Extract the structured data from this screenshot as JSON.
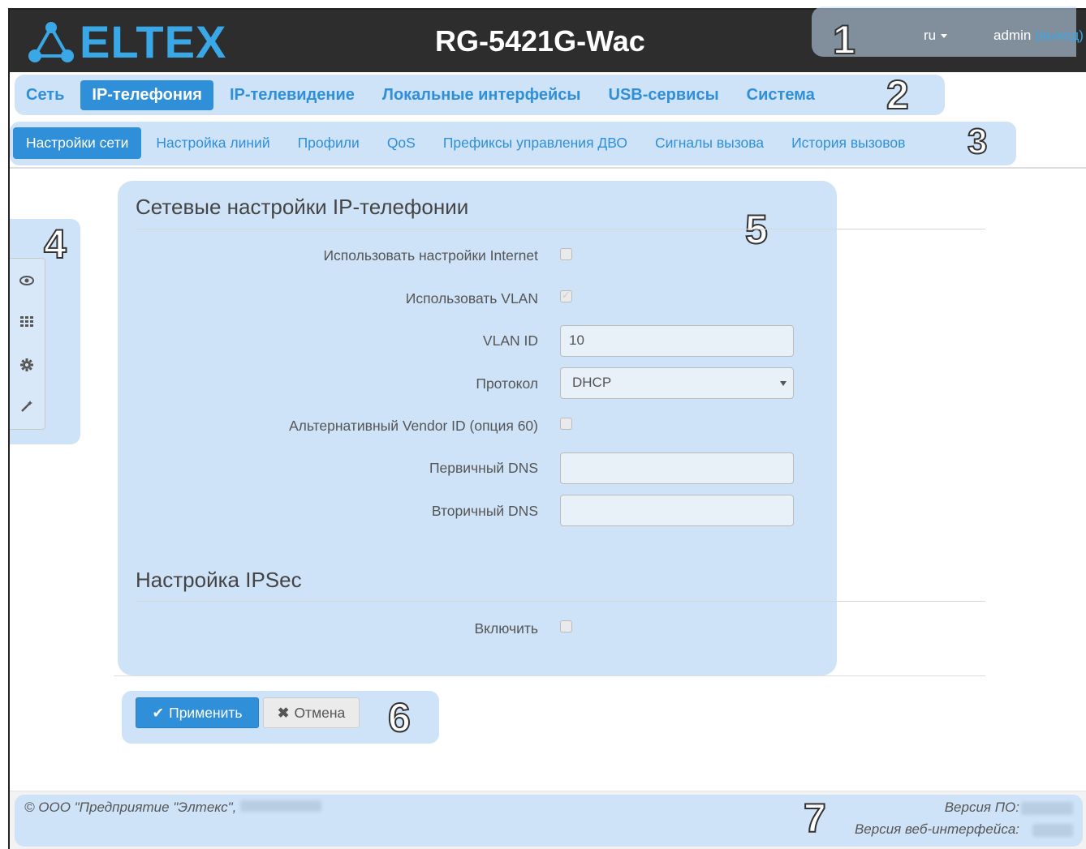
{
  "header": {
    "logo_text": "ELTEX",
    "model": "RG-5421G-Wac",
    "lang": "ru",
    "user": "admin",
    "logout": "(выход)"
  },
  "callouts": [
    "1",
    "2",
    "3",
    "4",
    "5",
    "6",
    "7"
  ],
  "main_nav": [
    {
      "label": "Сеть",
      "active": false
    },
    {
      "label": "IP-телефония",
      "active": true
    },
    {
      "label": "IP-телевидение",
      "active": false
    },
    {
      "label": "Локальные интерфейсы",
      "active": false
    },
    {
      "label": "USB-сервисы",
      "active": false
    },
    {
      "label": "Система",
      "active": false
    }
  ],
  "sub_nav": [
    {
      "label": "Настройки сети",
      "active": true
    },
    {
      "label": "Настройка линий",
      "active": false
    },
    {
      "label": "Профили",
      "active": false
    },
    {
      "label": "QoS",
      "active": false
    },
    {
      "label": "Префиксы управления ДВО",
      "active": false
    },
    {
      "label": "Сигналы вызова",
      "active": false
    },
    {
      "label": "История вызовов",
      "active": false
    }
  ],
  "sidebar": [
    "eye-icon",
    "grid-icon",
    "gear-icon",
    "wand-icon"
  ],
  "section1": {
    "title": "Сетевые настройки IP-телефонии",
    "use_internet_label": "Использовать настройки Internet",
    "use_internet_checked": false,
    "use_vlan_label": "Использовать VLAN",
    "use_vlan_checked": true,
    "vlan_id_label": "VLAN ID",
    "vlan_id_value": "10",
    "protocol_label": "Протокол",
    "protocol_value": "DHCP",
    "vendor_id_label": "Альтернативный Vendor ID (опция 60)",
    "vendor_id_checked": false,
    "primary_dns_label": "Первичный DNS",
    "primary_dns_value": "",
    "secondary_dns_label": "Вторичный DNS",
    "secondary_dns_value": ""
  },
  "section2": {
    "title": "Настройка IPSec",
    "enable_label": "Включить",
    "enable_checked": false
  },
  "buttons": {
    "apply": "Применить",
    "cancel": "Отмена"
  },
  "footer": {
    "copyright": "© ООО \"Предприятие \"Элтекс\",",
    "fw_version_label": "Версия ПО:",
    "web_version_label": "Версия веб-интерфейса:"
  }
}
